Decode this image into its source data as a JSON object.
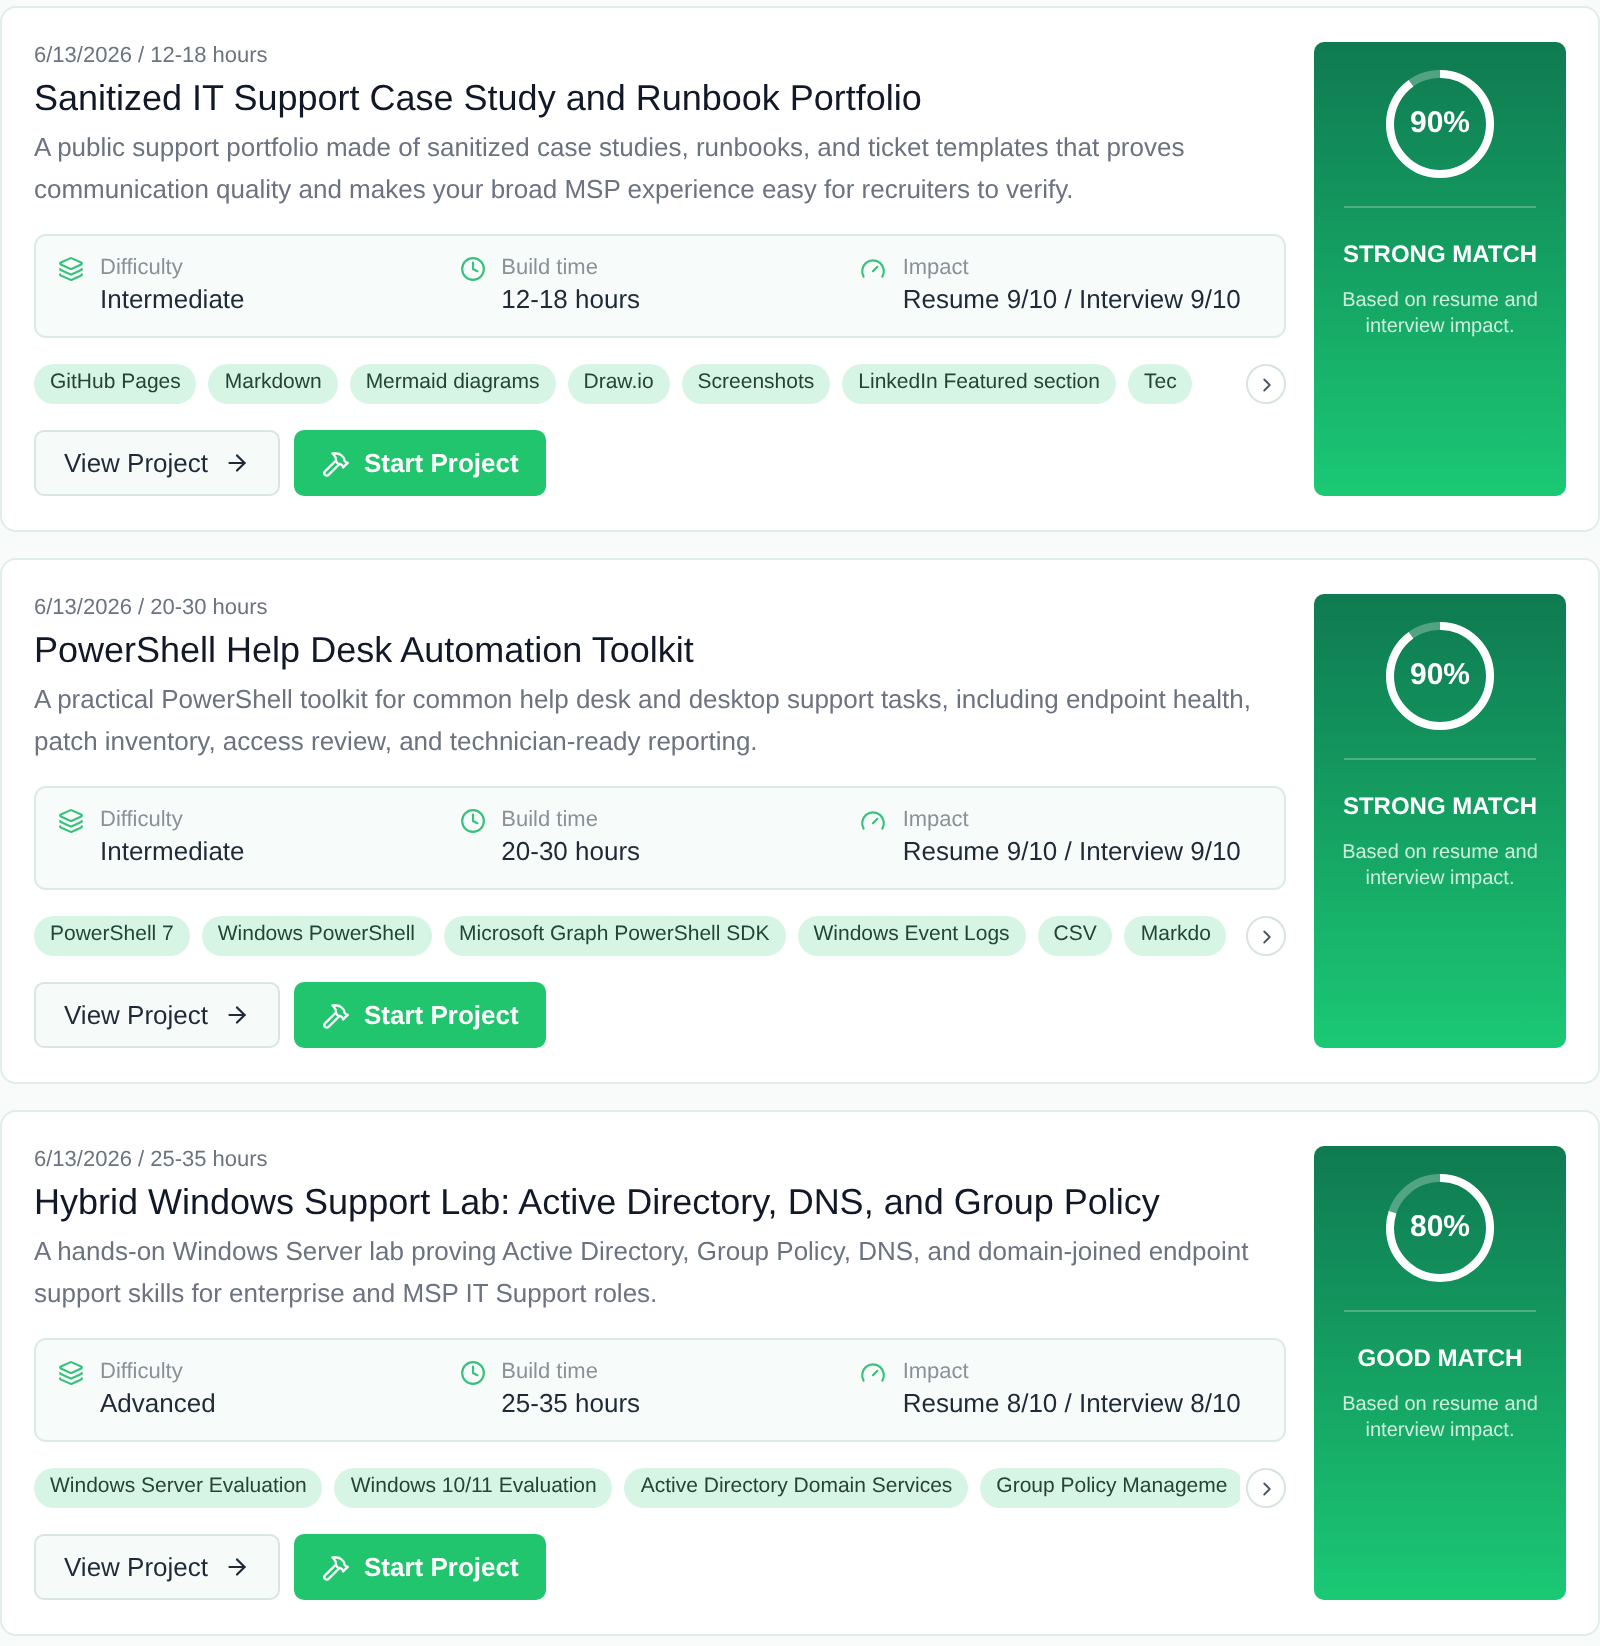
{
  "projects": [
    {
      "meta": "6/13/2026 / 12-18 hours",
      "title": "Sanitized IT Support Case Study and Runbook Portfolio",
      "description": "A public support portfolio made of sanitized case studies, runbooks, and ticket templates that proves communication quality and makes your broad MSP experience easy for recruiters to verify.",
      "stats": [
        {
          "kind": "difficulty",
          "label": "Difficulty",
          "value": "Intermediate"
        },
        {
          "kind": "build_time",
          "label": "Build time",
          "value": "12-18 hours"
        },
        {
          "kind": "impact",
          "label": "Impact",
          "value": "Resume 9/10 / Interview 9/10"
        }
      ],
      "tags": [
        "GitHub Pages",
        "Markdown",
        "Mermaid diagrams",
        "Draw.io",
        "Screenshots",
        "LinkedIn Featured section",
        "Tec"
      ],
      "actions": [
        {
          "kind": "secondary",
          "label": "View Project"
        },
        {
          "kind": "primary",
          "label": "Start Project"
        }
      ],
      "match": {
        "score": "90%",
        "level": 0.9,
        "label": "STRONG MATCH",
        "note": "Based on resume and interview impact."
      }
    },
    {
      "meta": "6/13/2026 / 20-30 hours",
      "title": "PowerShell Help Desk Automation Toolkit",
      "description": "A practical PowerShell toolkit for common help desk and desktop support tasks, including endpoint health, patch inventory, access review, and technician-ready reporting.",
      "stats": [
        {
          "kind": "difficulty",
          "label": "Difficulty",
          "value": "Intermediate"
        },
        {
          "kind": "build_time",
          "label": "Build time",
          "value": "20-30 hours"
        },
        {
          "kind": "impact",
          "label": "Impact",
          "value": "Resume 9/10 / Interview 9/10"
        }
      ],
      "tags": [
        "PowerShell 7",
        "Windows PowerShell",
        "Microsoft Graph PowerShell SDK",
        "Windows Event Logs",
        "CSV",
        "Markdo"
      ],
      "actions": [
        {
          "kind": "secondary",
          "label": "View Project"
        },
        {
          "kind": "primary",
          "label": "Start Project"
        }
      ],
      "match": {
        "score": "90%",
        "level": 0.9,
        "label": "STRONG MATCH",
        "note": "Based on resume and interview impact."
      }
    },
    {
      "meta": "6/13/2026 / 25-35 hours",
      "title": "Hybrid Windows Support Lab: Active Directory, DNS, and Group Policy",
      "description": "A hands-on Windows Server lab proving Active Directory, Group Policy, DNS, and domain-joined endpoint support skills for enterprise and MSP IT Support roles.",
      "stats": [
        {
          "kind": "difficulty",
          "label": "Difficulty",
          "value": "Advanced"
        },
        {
          "kind": "build_time",
          "label": "Build time",
          "value": "25-35 hours"
        },
        {
          "kind": "impact",
          "label": "Impact",
          "value": "Resume 8/10 / Interview 8/10"
        }
      ],
      "tags": [
        "Windows Server Evaluation",
        "Windows 10/11 Evaluation",
        "Active Directory Domain Services",
        "Group Policy Manageme"
      ],
      "actions": [
        {
          "kind": "secondary",
          "label": "View Project"
        },
        {
          "kind": "primary",
          "label": "Start Project"
        }
      ],
      "match": {
        "score": "80%",
        "level": 0.8,
        "label": "GOOD MATCH",
        "note": "Based on resume and interview impact."
      }
    }
  ]
}
